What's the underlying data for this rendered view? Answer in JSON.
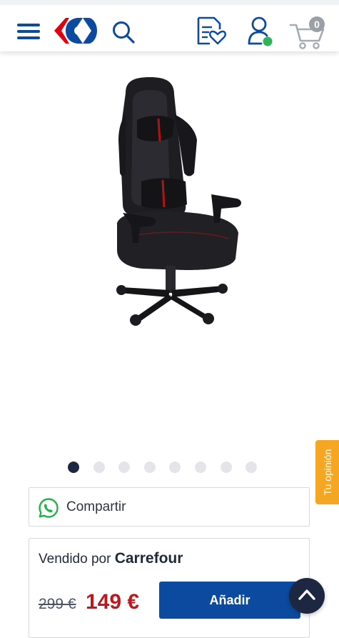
{
  "header": {
    "icons": [
      "menu-icon",
      "carrefour-logo",
      "search-icon",
      "shopping-list-icon",
      "account-icon",
      "cart-icon"
    ],
    "cart_count": "0",
    "brand_color": "#0b4a9f",
    "accent_red": "#e1000f",
    "online_status_color": "#2eb35b"
  },
  "gallery": {
    "image_subject": "black gaming chair",
    "slide_count": 8,
    "active_slide": 1
  },
  "share": {
    "label": "Compartir",
    "icon": "whatsapp-icon"
  },
  "product": {
    "seller_prefix": "Vendido por",
    "seller_name": "Carrefour",
    "old_price": "299 €",
    "price": "149 €",
    "add_label": "Añadir"
  },
  "feedback": {
    "label": "Tu opinión"
  },
  "scroll_top": {
    "icon": "chevron-up-icon"
  }
}
